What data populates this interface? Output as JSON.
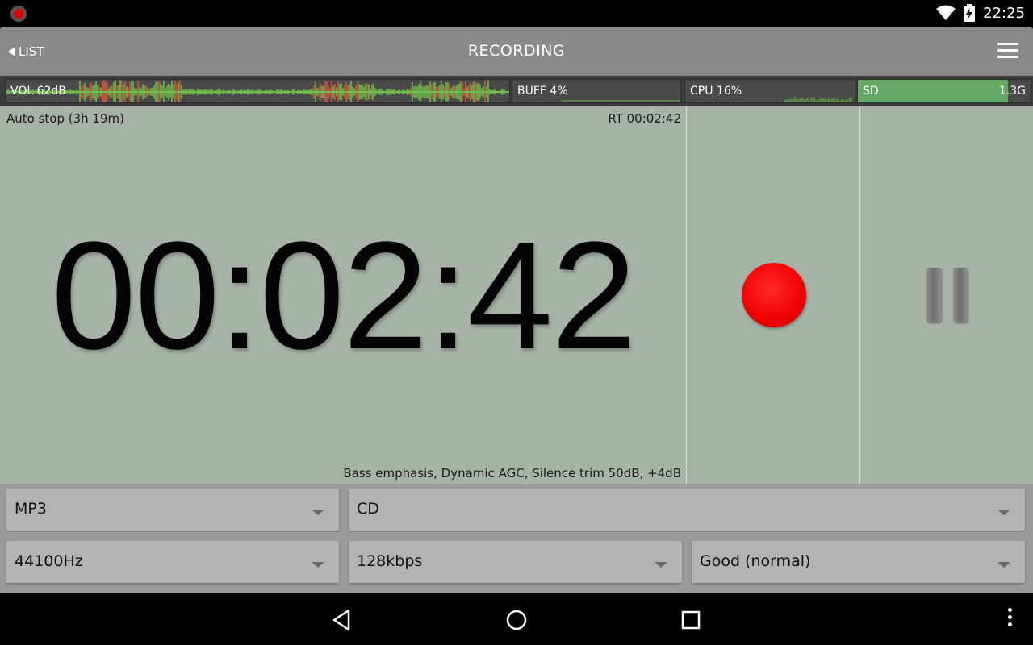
{
  "status_bar": {
    "time": "22:25",
    "icons": [
      "recording-app-icon",
      "wifi-icon",
      "battery-charging-icon"
    ]
  },
  "app_bar": {
    "back_label": "LIST",
    "title": "RECORDING",
    "icons": [
      "back-arrow-icon",
      "hamburger-menu-icon"
    ]
  },
  "meters": {
    "vol_label": "VOL 62dB",
    "buff_label": "BUFF 4%",
    "cpu_label": "CPU 16%",
    "sd_label": "SD",
    "sd_value": "1.3G",
    "sd_fill_fraction": 0.87,
    "colors": {
      "wave_green": "#6fbf4a",
      "wave_red": "#d9573a",
      "sd_green": "#66a866"
    }
  },
  "recording": {
    "auto_stop": "Auto stop (3h 19m)",
    "remaining_time": "RT 00:02:42",
    "timer": "00:02:42",
    "effects": "Bass emphasis, Dynamic AGC, Silence trim 50dB, +4dB",
    "record_color": "#f00000"
  },
  "settings": {
    "format": "MP3",
    "source": "CD",
    "sample_rate": "44100Hz",
    "bitrate": "128kbps",
    "quality": "Good (normal)"
  },
  "nav_bar": {
    "icons": [
      "nav-back-icon",
      "nav-home-icon",
      "nav-recents-icon",
      "overflow-menu-icon"
    ]
  }
}
